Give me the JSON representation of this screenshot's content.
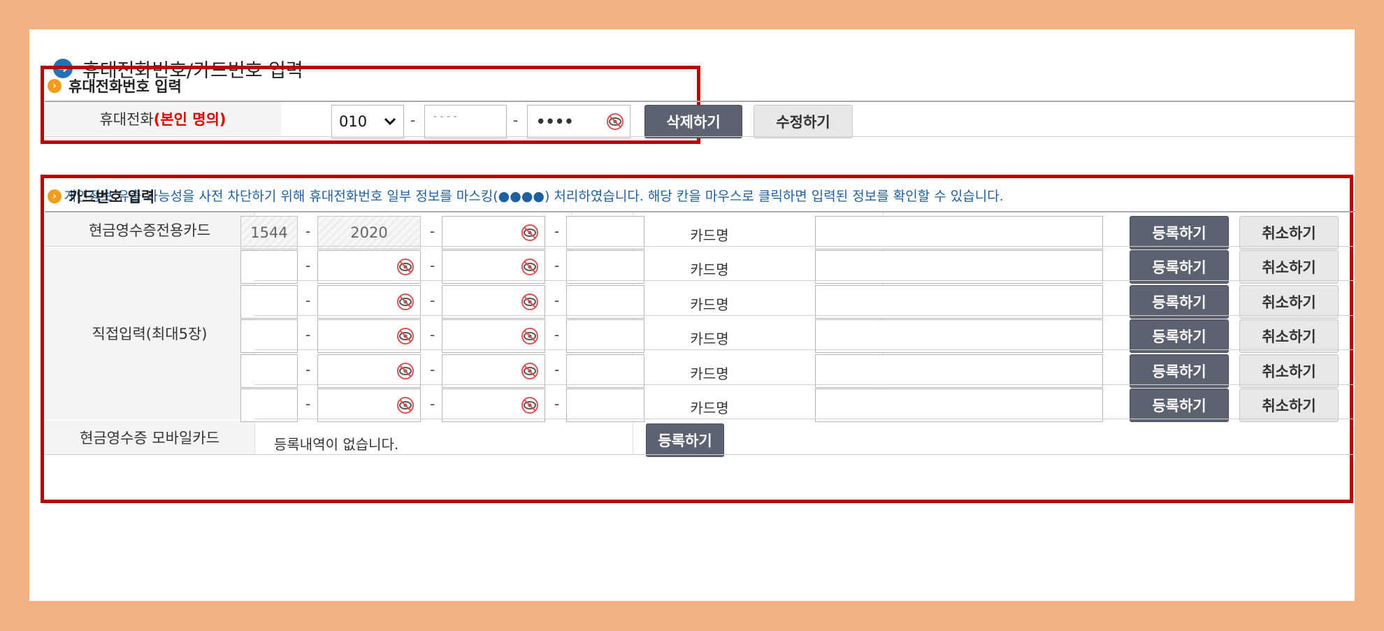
{
  "page_title": "휴대전화번호/카드번호 입력",
  "phone_section": {
    "title": "휴대전화번호 입력",
    "label_main": "휴대전화",
    "label_highlight": "(본인 명의)",
    "prefix": "010",
    "middle": "- - - -",
    "last": "••••",
    "dash": "-",
    "delete_label": "삭제하기",
    "edit_label": "수정하기"
  },
  "notice": "* 개인정보 유출 가능성을 사전 차단하기 위해 휴대전화번호 일부 정보를 마스킹(●●●●) 처리하였습니다. 해당 칸을 마우스로 클릭하면 입력된 정보를 확인할 수 있습니다.",
  "card_section": {
    "title": "카드번호 입력",
    "dash": "-",
    "card_name_label": "카드명",
    "register_label": "등록하기",
    "cancel_label": "취소하기",
    "dedicated_label": "현금영수증전용카드",
    "dedicated_part1": "1544",
    "dedicated_part2": "2020",
    "direct_label": "직접입력(최대5장)",
    "mobile_label": "현금영수증 모바일카드",
    "mobile_empty": "등록내역이 없습니다.",
    "mobile_register_label": "등록하기"
  },
  "colors": {
    "accent_red": "#b80000",
    "dark_button": "#5d6270",
    "notice_blue": "#1f5f9e",
    "background": "#f4b183"
  }
}
